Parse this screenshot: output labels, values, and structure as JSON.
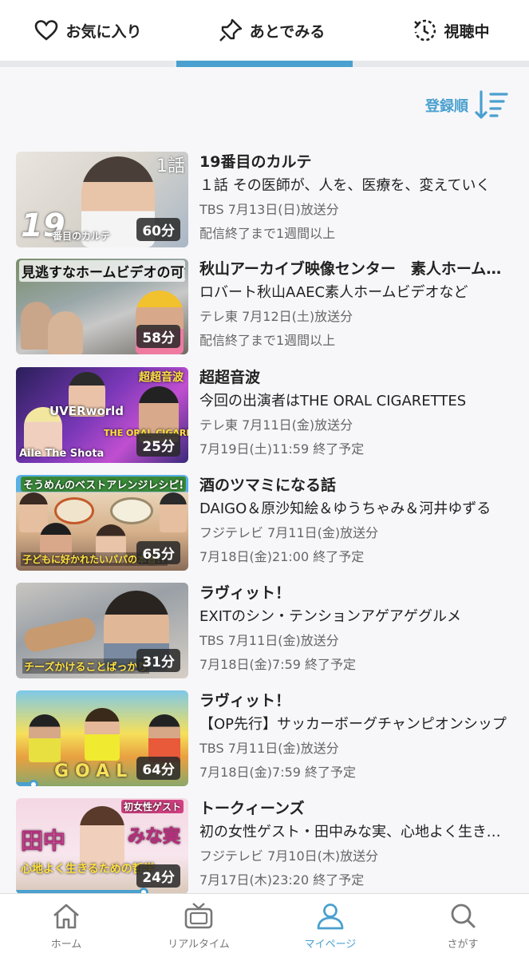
{
  "tabs": [
    {
      "label": "お気に入り",
      "icon": "heart-icon"
    },
    {
      "label": "あとでみる",
      "icon": "pin-icon",
      "active": true
    },
    {
      "label": "視聴中",
      "icon": "history-icon"
    }
  ],
  "sort": {
    "label": "登録順",
    "icon": "sort-icon"
  },
  "colors": {
    "accent": "#4aa0cf"
  },
  "items": [
    {
      "title": "19番目のカルテ",
      "desc": "１話 その医師が、人を、医療を、変えていく",
      "air": "TBS 7月13日(日)放送分",
      "expire": "配信終了まで1週間以上",
      "duration": "60分",
      "thumb_episode": "1話",
      "thumb_big": "19",
      "thumb_sub": "番目のカルテ"
    },
    {
      "title": "秋山アーカイブ映像センター　素人ホームビデオ",
      "desc": "ロバート秋山AAEC素人ホームビデオなど",
      "air": "テレ東 7月12日(土)放送分",
      "expire": "配信終了まで1週間以上",
      "duration": "58分",
      "thumb_caption": "見逃すなホームビデオの可能性"
    },
    {
      "title": "超超音波",
      "desc": "今回の出演者はTHE ORAL CIGARETTES",
      "air": "テレ東 7月11日(金)放送分",
      "expire": "7月19日(土)11:59 終了予定",
      "duration": "25分",
      "thumb_texts": [
        "超超音波",
        "UVERworld",
        "THE ORAL CIGARETTES",
        "Aile The Shota"
      ]
    },
    {
      "title": "酒のツマミになる話",
      "desc": "DAIGO＆原沙知絵＆ゆうちゃみ＆河井ゆずる",
      "air": "フジテレビ 7月11日(金)放送分",
      "expire": "7月18日(金)21:00 終了予定",
      "duration": "65分",
      "thumb_texts": [
        "そうめんのベストアレンジレシピ!",
        "子どもに好かれたいパパの本音!?"
      ]
    },
    {
      "title": "ラヴィット！",
      "desc": "EXITのシン・テンションアゲアゲグルメ",
      "air": "TBS 7月11日(金)放送分",
      "expire": "7月18日(金)7:59 終了予定",
      "duration": "31分",
      "thumb_texts": [
        "チーズかけることばっかり"
      ]
    },
    {
      "title": "ラヴィット！",
      "desc": "【OP先行】サッカーボーグチャンピオンシップ",
      "air": "TBS 7月11日(金)放送分",
      "expire": "7月18日(金)7:59 終了予定",
      "duration": "64分",
      "progress": 0.1,
      "thumb_texts": [
        "GOAL"
      ]
    },
    {
      "title": "トークィーンズ",
      "desc": "初の女性ゲスト・田中みな実、心地よく生きるための哲学",
      "air": "フジテレビ 7月10日(木)放送分",
      "expire": "7月17日(木)23:20 終了予定",
      "duration": "24分",
      "progress": 0.74,
      "thumb_texts": [
        "初女性ゲスト",
        "田中",
        "みな実",
        "心地よく生きるための哲学"
      ]
    }
  ],
  "bottom_nav": [
    {
      "label": "ホーム",
      "icon": "home-icon"
    },
    {
      "label": "リアルタイム",
      "icon": "tv-icon"
    },
    {
      "label": "マイページ",
      "icon": "person-icon",
      "active": true
    },
    {
      "label": "さがす",
      "icon": "search-icon"
    }
  ]
}
